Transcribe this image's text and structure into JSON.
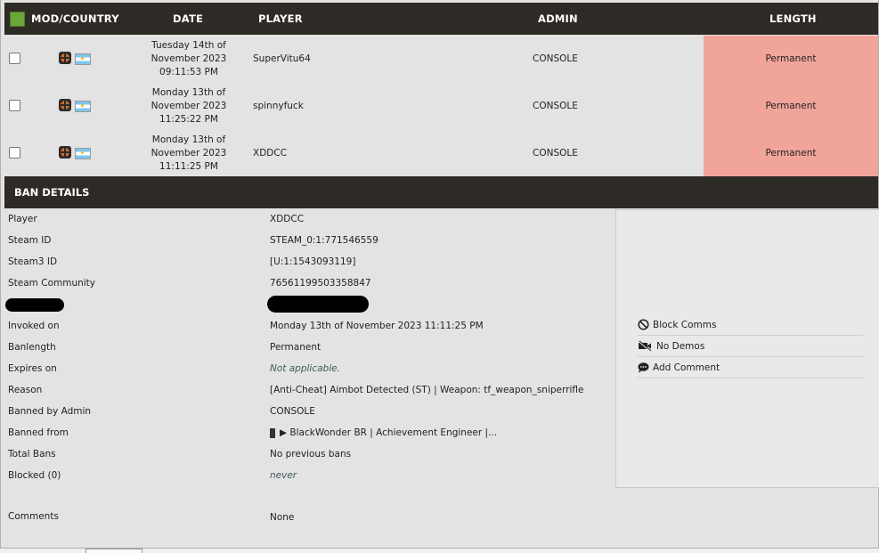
{
  "table": {
    "headers": {
      "mod_country": "MOD/COUNTRY",
      "date": "DATE",
      "player": "PLAYER",
      "admin": "ADMIN",
      "length": "LENGTH"
    },
    "rows": [
      {
        "date_line1": "Tuesday 14th of",
        "date_line2": "November 2023",
        "date_line3": "09:11:53 PM",
        "player": "SuperVitu64",
        "admin": "CONSOLE",
        "length": "Permanent"
      },
      {
        "date_line1": "Monday 13th of",
        "date_line2": "November 2023",
        "date_line3": "11:25:22 PM",
        "player": "spinnyfuck",
        "admin": "CONSOLE",
        "length": "Permanent"
      },
      {
        "date_line1": "Monday 13th of",
        "date_line2": "November 2023",
        "date_line3": "11:11:25 PM",
        "player": "XDDCC",
        "admin": "CONSOLE",
        "length": "Permanent"
      }
    ],
    "colors": {
      "header_bg": "#2e2a25",
      "permanent_bg": "#f1a49a",
      "select_all": "#6aa63a"
    }
  },
  "details": {
    "title": "BAN DETAILS",
    "fields": [
      {
        "label": "Player",
        "value": "XDDCC"
      },
      {
        "label": "Steam ID",
        "value": "STEAM_0:1:771546559"
      },
      {
        "label": "Steam3 ID",
        "value": "[U:1:1543093119]"
      },
      {
        "label": "Steam Community",
        "value": "76561199503358847"
      },
      {
        "label": "Invoked on",
        "value": "Monday 13th of November 2023 11:11:25 PM"
      },
      {
        "label": "Banlength",
        "value": "Permanent"
      },
      {
        "label": "Expires on",
        "value": "Not applicable."
      },
      {
        "label": "Reason",
        "value": "[Anti-Cheat] Aimbot Detected (ST) | Weapon: tf_weapon_sniperrifle"
      },
      {
        "label": "Banned by Admin",
        "value": "CONSOLE"
      },
      {
        "label": "Banned from",
        "value": "▶ BlackWonder BR | Achievement Engineer |..."
      },
      {
        "label": "Total Bans",
        "value": "No previous bans"
      },
      {
        "label": "Blocked (0)",
        "value": "never"
      },
      {
        "label": "Comments",
        "value": "None"
      }
    ],
    "actions": [
      {
        "label": "Block Comms",
        "icon": "block-icon"
      },
      {
        "label": "No Demos",
        "icon": "video-off-icon"
      },
      {
        "label": "Add Comment",
        "icon": "comment-icon"
      }
    ]
  }
}
